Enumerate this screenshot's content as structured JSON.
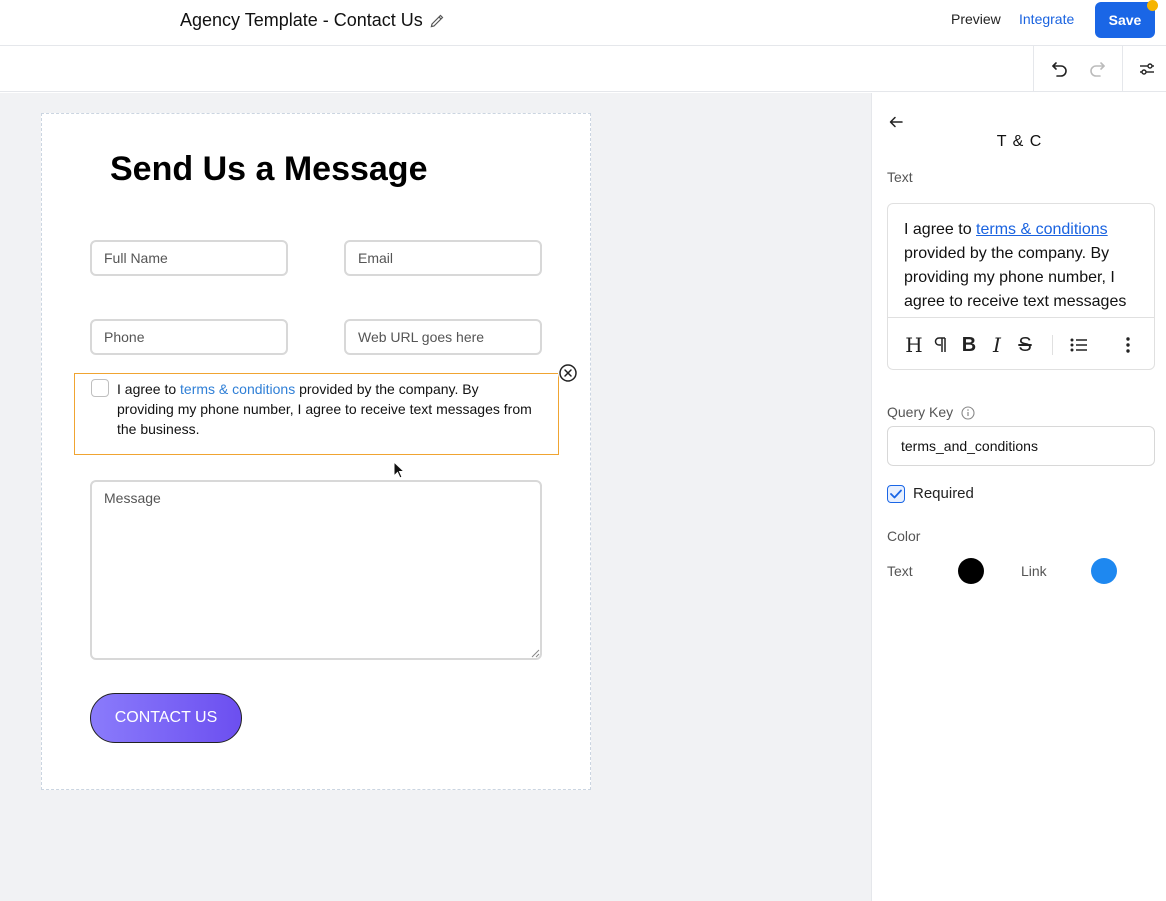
{
  "header": {
    "title": "Agency Template - Contact Us",
    "preview_label": "Preview",
    "integrate_label": "Integrate",
    "save_label": "Save"
  },
  "form": {
    "heading": "Send Us a Message",
    "fields": {
      "full_name_placeholder": "Full Name",
      "email_placeholder": "Email",
      "phone_placeholder": "Phone",
      "web_url_placeholder": "Web URL goes here",
      "message_placeholder": "Message"
    },
    "terms": {
      "prefix": "I agree to ",
      "link": "terms & conditions",
      "suffix": " provided by the company. By providing my phone number, I agree to receive text messages from the business."
    },
    "submit_label": "CONTACT US"
  },
  "panel": {
    "title": "T & C",
    "text_label": "Text",
    "editor": {
      "prefix": "I agree to ",
      "link": "terms & conditions",
      "suffix": " provided by the company. By providing my phone number, I agree to receive text messages"
    },
    "query_key_label": "Query Key",
    "query_key_value": "terms_and_conditions",
    "required_label": "Required",
    "color_label": "Color",
    "text_color_label": "Text",
    "link_color_label": "Link"
  },
  "colors": {
    "accent": "#1a66e6",
    "selection_border": "#f0a431",
    "text_color": "#000000",
    "link_color": "#1e88f0"
  }
}
